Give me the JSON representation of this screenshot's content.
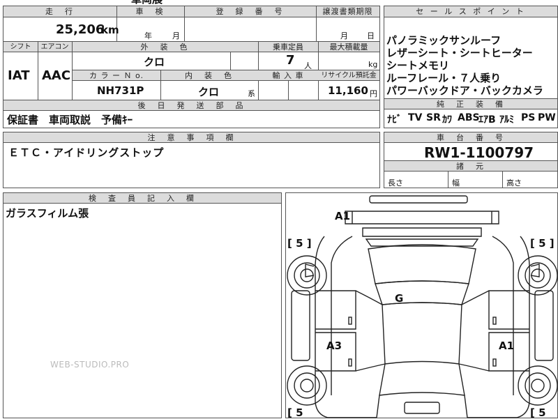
{
  "top_fragment": "車両展",
  "mileage": {
    "header": "走　行",
    "value": "25,206",
    "unit": "km"
  },
  "inspection": {
    "header": "車　検",
    "year_unit": "年",
    "month_unit": "月"
  },
  "registration": {
    "header": "登　録　番　号"
  },
  "transfer_deadline": {
    "header": "譲渡書類期限",
    "month_unit": "月",
    "day_unit": "日"
  },
  "shift": {
    "header": "シフト",
    "value": "IAT"
  },
  "aircon": {
    "header": "エアコン",
    "value": "AAC"
  },
  "exterior_color": {
    "header": "外　装　色",
    "value": "クロ"
  },
  "color_no": {
    "header": "カ ラ ー Ｎ o.",
    "value": "NH731P"
  },
  "interior_color": {
    "header": "内　装　色",
    "value": "クロ",
    "suffix": "系"
  },
  "capacity": {
    "header": "乗車定員",
    "value": "7",
    "unit": "人"
  },
  "import": {
    "header": "輸 入 車"
  },
  "max_load": {
    "header": "最大積載量",
    "unit": "kg"
  },
  "recycle": {
    "header": "リサイクル預託金",
    "value": "11,160",
    "unit": "円"
  },
  "accessories": {
    "header": "後　日　発　送　部　品",
    "value": "保証書　車両取説　予備ｷｰ"
  },
  "notes": {
    "header": "注　意　事　項　欄",
    "value": "ＥＴＣ・アイドリングストップ"
  },
  "inspector": {
    "header": "検　査　員　記　入　欄",
    "value": "ガラスフィルム張"
  },
  "sales_points": {
    "header": "セ ー ル ス ポ イ ン ト",
    "lines": [
      "パノラミックサンルーフ",
      "レザーシート・シートヒーター",
      "シートメモリ",
      "ルーフレール・７人乗り",
      "パワーバックドア・バックカメラ"
    ]
  },
  "genuine_equipment": {
    "header": "純　正　装　備",
    "items": [
      "ﾅﾋﾞ",
      "TV",
      "SR",
      "ｶﾜ",
      "ABS",
      "ｴｱB",
      "ｱﾙﾐ",
      "PS",
      "PW"
    ]
  },
  "chassis": {
    "header": "車　台　番　号",
    "value": "RW1-1100797"
  },
  "dimensions": {
    "header": "諸　元",
    "length": "長さ",
    "width": "幅",
    "height": "高さ"
  },
  "diagram": {
    "marks": {
      "front": "A1",
      "center": "G",
      "left": "A3",
      "right": "A1"
    },
    "tire_left_front": "[ 5 ]",
    "tire_right_front": "[ 5 ]",
    "tire_left_rear": "[ 5",
    "tire_right_rear": "[ 5"
  },
  "watermark": "WEB-STUDIO.PRO"
}
